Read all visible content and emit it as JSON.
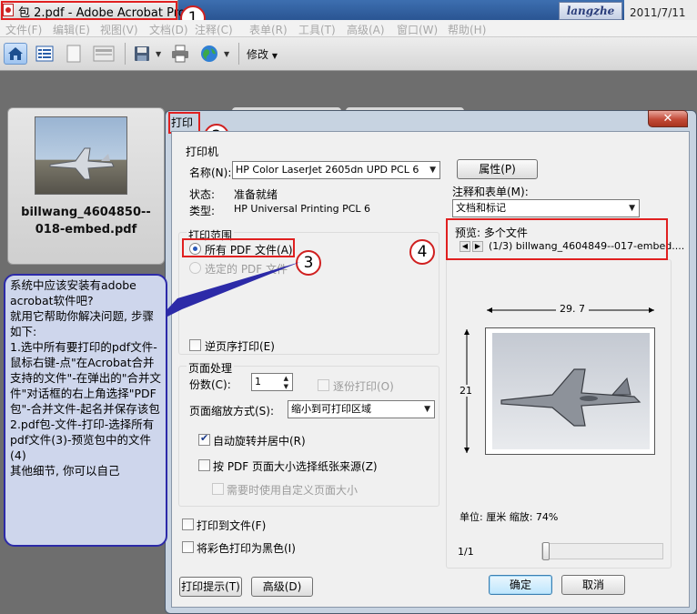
{
  "window": {
    "title": "包 2.pdf - Adobe Acrobat Pro",
    "user": "langzhe",
    "date": "2011/7/11"
  },
  "menu": [
    "文件(F)",
    "编辑(E)",
    "视图(V)",
    "文档(D)",
    "注释(C)",
    "表单(R)",
    "工具(T)",
    "高级(A)",
    "窗口(W)",
    "帮助(H)"
  ],
  "toolbar": {
    "modify_label": "修改"
  },
  "file_thumb": {
    "name_line1": "billwang_4604850--",
    "name_line2": "018-embed.pdf"
  },
  "callout": {
    "text": "系统中应该安装有adobe acrobat软件吧?\n就用它帮助你解决问题, 步骤如下:\n1.选中所有要打印的pdf文件-鼠标右键-点\"在Acrobat合并支持的文件\"-在弹出的\"合并文件\"对话框的右上角选择\"PDF包\"-合并文件-起名并保存该包\n2.pdf包-文件-打印-选择所有pdf文件(3)-预览包中的文件(4)\n其他细节, 你可以自己"
  },
  "dialog": {
    "title": "打印",
    "close": "✕",
    "printer": {
      "section": "打印机",
      "name_label": "名称(N):",
      "name_value": "HP Color LaserJet 2605dn UPD PCL 6",
      "properties_button": "属性(P)",
      "status_label": "状态:",
      "status_value": "准备就绪",
      "type_label": "类型:",
      "type_value": "HP Universal Printing PCL 6"
    },
    "comments": {
      "label": "注释和表单(M):",
      "value": "文档和标记"
    },
    "range": {
      "section": "打印范围",
      "all_pdf": "所有 PDF 文件(A)",
      "selected_pdf": "选定的 PDF 文件",
      "reverse": "逆页序打印(E)"
    },
    "preview": {
      "label": "预览:",
      "label_value": "多个文件",
      "nav_text": "(1/3)  billwang_4604849--017-embed....",
      "width": "29. 7",
      "height": "21",
      "units": "单位: 厘米  缩放:  74%",
      "page": "1/1"
    },
    "handling": {
      "section": "页面处理",
      "copies_label": "份数(C):",
      "copies_value": "1",
      "collate": "逐份打印(O)",
      "scaling_label": "页面缩放方式(S):",
      "scaling_value": "缩小到可打印区域",
      "auto_rotate": "自动旋转并居中(R)",
      "choose_paper": "按 PDF 页面大小选择纸张来源(Z)",
      "custom_size": "需要时使用自定义页面大小"
    },
    "print_to_file": "打印到文件(F)",
    "print_black": "将彩色打印为黑色(I)",
    "buttons": {
      "tips": "打印提示(T)",
      "advanced": "高级(D)",
      "ok": "确定",
      "cancel": "取消"
    }
  },
  "annotations": [
    "1",
    "2",
    "3",
    "4"
  ]
}
